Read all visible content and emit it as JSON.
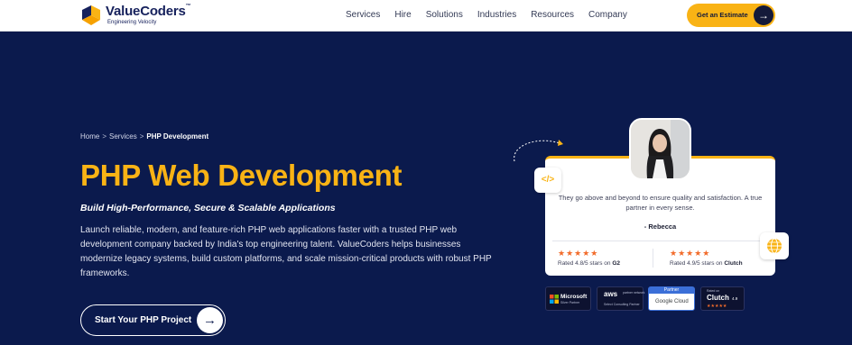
{
  "nav": {
    "logo": {
      "name": "ValueCoders",
      "trademark": "™",
      "subtitle": "Engineering Velocity"
    },
    "links": [
      "Services",
      "Hire",
      "Solutions",
      "Industries",
      "Resources",
      "Company"
    ],
    "cta_label": "Get an Estimate"
  },
  "breadcrumb": {
    "items": [
      "Home",
      "Services"
    ],
    "current": "PHP Development",
    "separator": ">"
  },
  "hero": {
    "title": "PHP Web Development",
    "tagline": "Build High-Performance, Secure & Scalable Applications",
    "intro": "Launch reliable, modern, and feature-rich PHP web applications faster with a trusted PHP web development company backed by India's top engineering talent. ValueCoders helps businesses modernize legacy systems, build custom platforms, and scale mission-critical products with robust PHP frameworks.",
    "cta_label": "Start Your PHP Project"
  },
  "testimonial": {
    "quote": "They go above and beyond to ensure quality and satisfaction. A true partner in every sense.",
    "author": "- Rebecca",
    "ratings": [
      {
        "stars": "★★★★★",
        "text": "Rated 4.8/5 stars on",
        "platform": "G2"
      },
      {
        "stars": "★★★★★",
        "text": "Rated 4.9/5 stars on",
        "platform": "Clutch"
      }
    ],
    "code_icon": "</>"
  },
  "badges": {
    "microsoft": {
      "title": "Microsoft",
      "sub": "Silver Partner"
    },
    "aws": {
      "title": "aws",
      "sub": "partner network",
      "sub2": "Select Consulting Partner"
    },
    "google": {
      "top": "Partner",
      "title": "Google Cloud"
    },
    "clutch": {
      "top": "Rated on",
      "title": "Clutch",
      "score": "4.9",
      "stars": "★★★★★"
    }
  },
  "colors": {
    "accent": "#f9b315",
    "background": "#0b1a4d",
    "star": "#f26b2a"
  },
  "icons": [
    "logo-icon",
    "arrow-right-icon",
    "code-icon",
    "globe-icon",
    "star-icon"
  ]
}
